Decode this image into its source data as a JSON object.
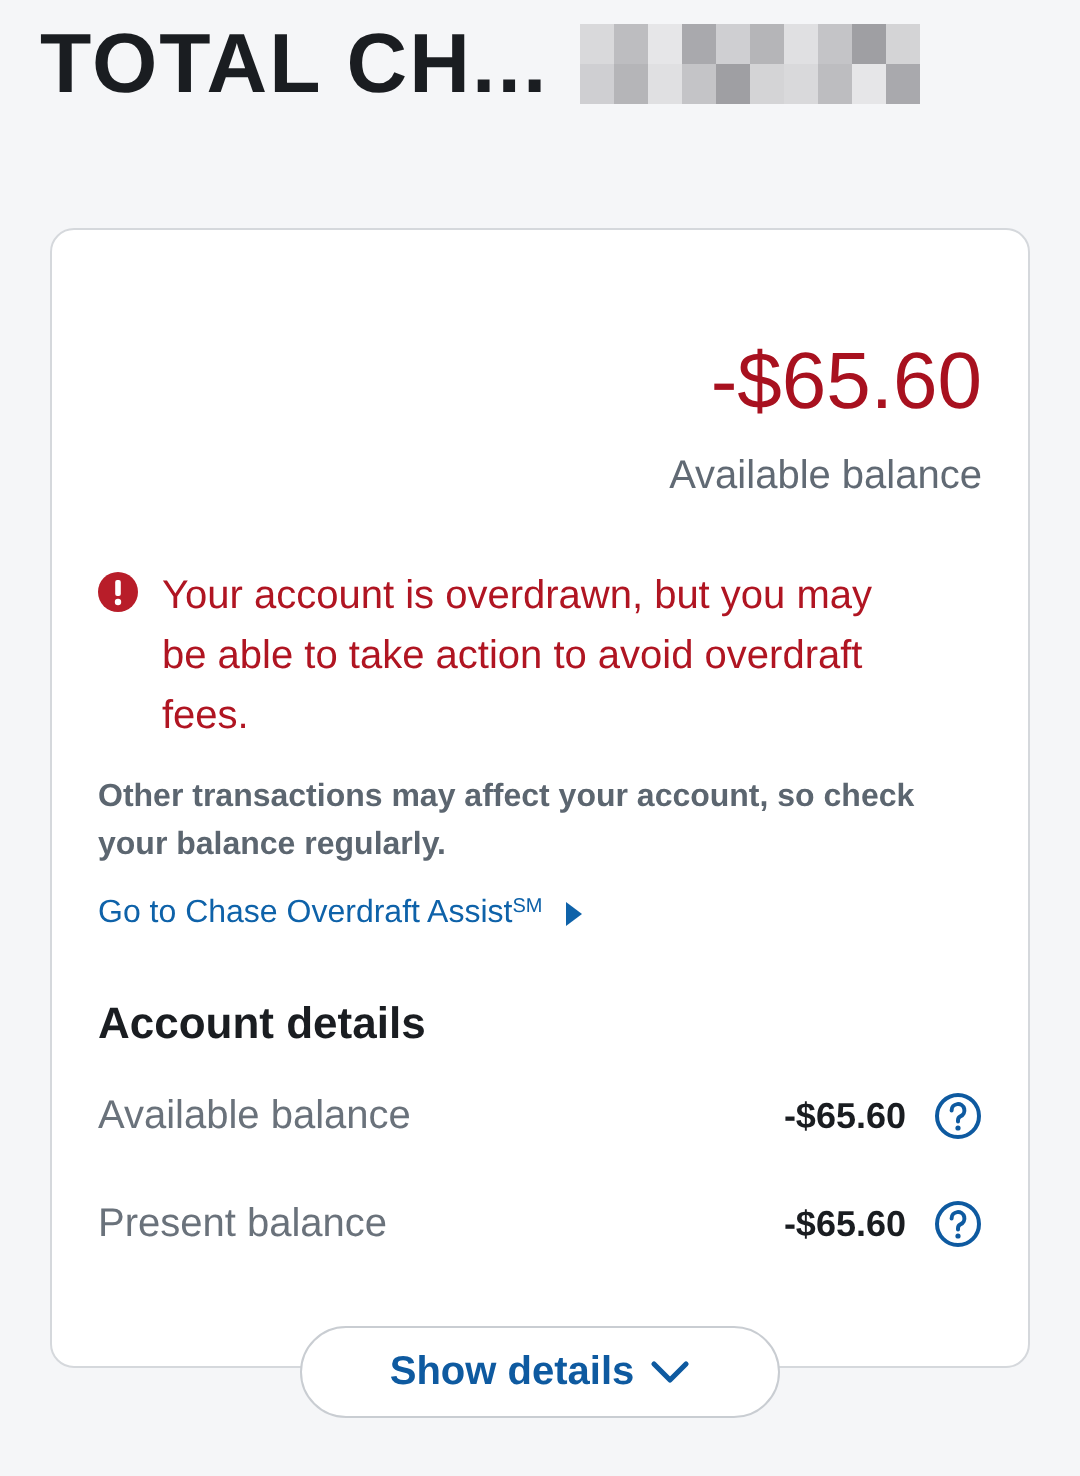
{
  "header": {
    "title": "TOTAL CH..."
  },
  "balance": {
    "amount": "-$65.60",
    "label": "Available balance"
  },
  "alert": {
    "message": "Your account is overdrawn, but you may be able to take action to avoid overdraft fees."
  },
  "note": "Other transactions may affect your account, so check your balance regularly.",
  "link": "Go to Chase Overdraft Assist$^{SM}$",
  "account_details": {
    "title": "Account details",
    "rows": [
      {
        "label": "Available balance",
        "value": "-$65.60"
      },
      {
        "label": "Present balance",
        "value": "-$65.60"
      }
    ]
  },
  "show_details_button": "Show details"
}
